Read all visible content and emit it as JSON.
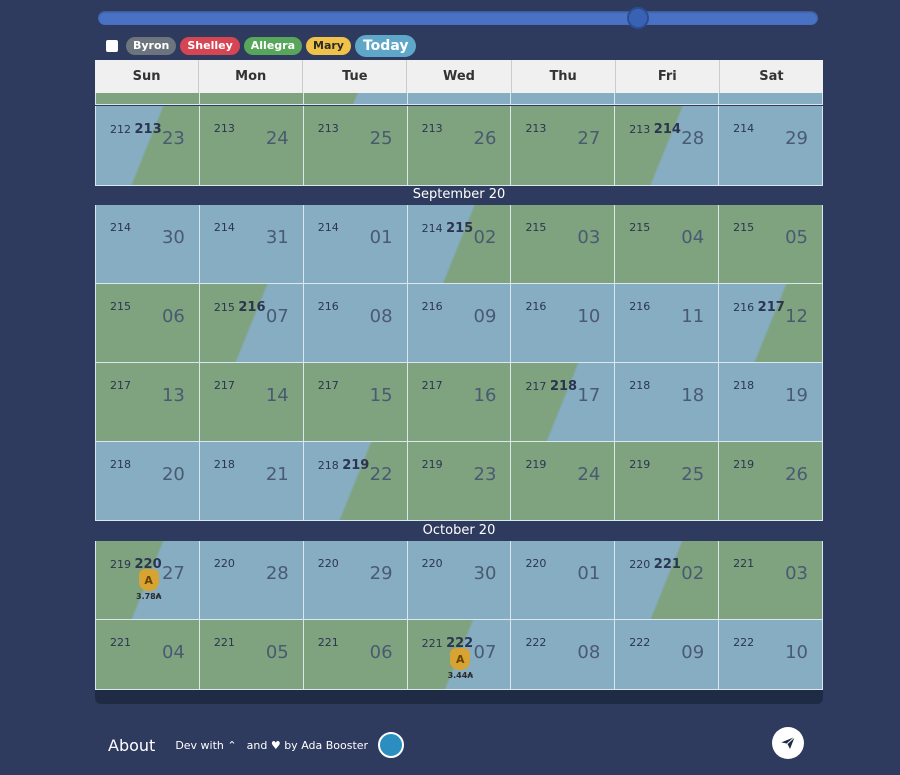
{
  "filters": {
    "slider_value": 0.75,
    "people": [
      {
        "name": "Byron",
        "color": "#6c757d"
      },
      {
        "name": "Shelley",
        "color": "#d64553"
      },
      {
        "name": "Allegra",
        "color": "#58a65c"
      },
      {
        "name": "Mary",
        "color": "#f0c24a"
      }
    ],
    "today_label": "Today"
  },
  "calendar": {
    "weekdays": [
      "Sun",
      "Mon",
      "Tue",
      "Wed",
      "Thu",
      "Fri",
      "Sat"
    ],
    "colors": {
      "green": "#7fa27f",
      "blue": "#86adc1"
    },
    "month_labels": [
      "September 20",
      "October 20"
    ],
    "rows": [
      [
        {
          "d": "23",
          "n": "212",
          "b": "213",
          "bg": "split-bg"
        },
        {
          "d": "24",
          "n": "213",
          "bg": "green"
        },
        {
          "d": "25",
          "n": "213",
          "bg": "green"
        },
        {
          "d": "26",
          "n": "213",
          "bg": "green"
        },
        {
          "d": "27",
          "n": "213",
          "bg": "green"
        },
        {
          "d": "28",
          "n": "213",
          "b": "214",
          "bg": "split-gb"
        },
        {
          "d": "29",
          "n": "214",
          "bg": "blue"
        }
      ],
      [
        {
          "d": "30",
          "n": "214",
          "bg": "blue"
        },
        {
          "d": "31",
          "n": "214",
          "bg": "blue"
        },
        {
          "d": "01",
          "n": "214",
          "bg": "blue"
        },
        {
          "d": "02",
          "n": "214",
          "b": "215",
          "bg": "split-bg"
        },
        {
          "d": "03",
          "n": "215",
          "bg": "green"
        },
        {
          "d": "04",
          "n": "215",
          "bg": "green"
        },
        {
          "d": "05",
          "n": "215",
          "bg": "green"
        }
      ],
      [
        {
          "d": "06",
          "n": "215",
          "bg": "green"
        },
        {
          "d": "07",
          "n": "215",
          "b": "216",
          "bg": "split-gb"
        },
        {
          "d": "08",
          "n": "216",
          "bg": "blue"
        },
        {
          "d": "09",
          "n": "216",
          "bg": "blue"
        },
        {
          "d": "10",
          "n": "216",
          "bg": "blue"
        },
        {
          "d": "11",
          "n": "216",
          "bg": "blue"
        },
        {
          "d": "12",
          "n": "216",
          "b": "217",
          "bg": "split-bg"
        }
      ],
      [
        {
          "d": "13",
          "n": "217",
          "bg": "green"
        },
        {
          "d": "14",
          "n": "217",
          "bg": "green"
        },
        {
          "d": "15",
          "n": "217",
          "bg": "green"
        },
        {
          "d": "16",
          "n": "217",
          "bg": "green"
        },
        {
          "d": "17",
          "n": "217",
          "b": "218",
          "bg": "split-gb"
        },
        {
          "d": "18",
          "n": "218",
          "bg": "blue"
        },
        {
          "d": "19",
          "n": "218",
          "bg": "blue"
        }
      ],
      [
        {
          "d": "20",
          "n": "218",
          "bg": "blue"
        },
        {
          "d": "21",
          "n": "218",
          "bg": "blue"
        },
        {
          "d": "22",
          "n": "218",
          "b": "219",
          "bg": "split-bg"
        },
        {
          "d": "23",
          "n": "219",
          "bg": "green"
        },
        {
          "d": "24",
          "n": "219",
          "bg": "green"
        },
        {
          "d": "25",
          "n": "219",
          "bg": "green"
        },
        {
          "d": "26",
          "n": "219",
          "bg": "green"
        }
      ],
      [
        {
          "d": "27",
          "n": "219",
          "b": "220",
          "bg": "split-gb",
          "reward": "3.78₳"
        },
        {
          "d": "28",
          "n": "220",
          "bg": "blue"
        },
        {
          "d": "29",
          "n": "220",
          "bg": "blue"
        },
        {
          "d": "30",
          "n": "220",
          "bg": "blue"
        },
        {
          "d": "01",
          "n": "220",
          "bg": "blue"
        },
        {
          "d": "02",
          "n": "220",
          "b": "221",
          "bg": "split-bg"
        },
        {
          "d": "03",
          "n": "221",
          "bg": "green"
        }
      ],
      [
        {
          "d": "04",
          "n": "221",
          "bg": "green"
        },
        {
          "d": "05",
          "n": "221",
          "bg": "green"
        },
        {
          "d": "06",
          "n": "221",
          "bg": "green"
        },
        {
          "d": "07",
          "n": "221",
          "b": "222",
          "bg": "split-gb",
          "reward": "3.44₳"
        },
        {
          "d": "08",
          "n": "222",
          "bg": "blue"
        },
        {
          "d": "09",
          "n": "222",
          "bg": "blue"
        },
        {
          "d": "10",
          "n": "222",
          "bg": "blue"
        }
      ]
    ]
  },
  "footer": {
    "about": "About",
    "dev_with": "Dev with",
    "and_by": "and",
    "by_label": "by Ada Booster"
  }
}
